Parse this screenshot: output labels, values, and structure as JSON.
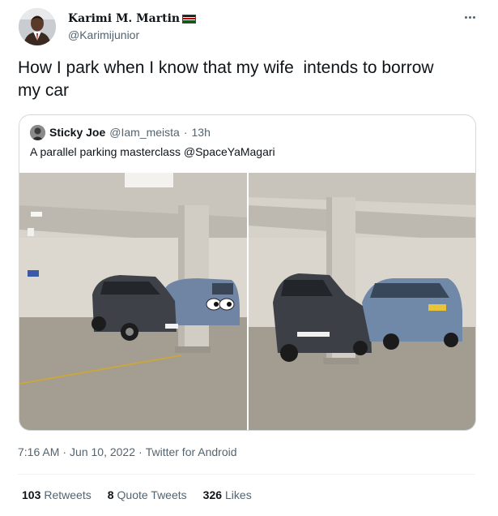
{
  "author": {
    "display_name": "Karimi M. Martin",
    "handle": "@Karimijunior",
    "badge_icon": "kenya-flag-icon"
  },
  "tweet": {
    "text": "How I park when I know that my wife  intends to borrow\nmy car",
    "more_icon": "more-options-icon"
  },
  "quote": {
    "name": "Sticky Joe",
    "handle": "@Iam_meista",
    "separator": "·",
    "time": "13h",
    "text": "A parallel parking masterclass @SpaceYaMagari",
    "photos": [
      "parking-photo-left",
      "parking-photo-right"
    ]
  },
  "meta": {
    "time": "7:16 AM",
    "sep1": "·",
    "date": "Jun 10, 2022",
    "sep2": "·",
    "source": "Twitter for Android"
  },
  "stats": {
    "retweets_count": "103",
    "retweets_label": "Retweets",
    "quotes_count": "8",
    "quotes_label": "Quote Tweets",
    "likes_count": "326",
    "likes_label": "Likes"
  },
  "colors": {
    "text_primary": "#0f1419",
    "text_secondary": "#536471",
    "border": "#cfd9de"
  }
}
